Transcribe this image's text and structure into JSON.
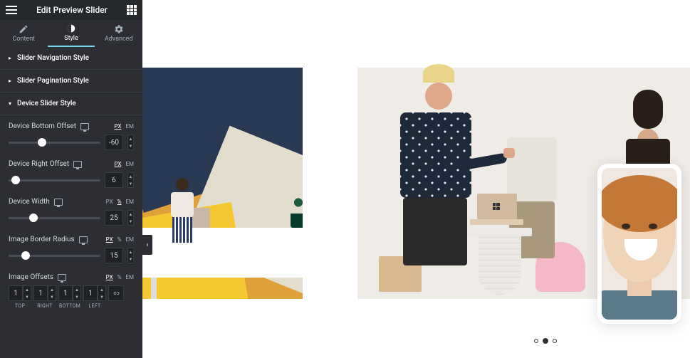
{
  "header": {
    "title": "Edit Preview Slider"
  },
  "tabs": {
    "content": "Content",
    "style": "Style",
    "advanced": "Advanced"
  },
  "sections": {
    "nav": "Slider Navigation Style",
    "pag": "Slider Pagination Style",
    "device": "Device Slider Style"
  },
  "controls": {
    "bottom_offset": {
      "label": "Device Bottom Offset",
      "value": "-60",
      "units": [
        "PX",
        "EM"
      ],
      "active_unit": "PX"
    },
    "right_offset": {
      "label": "Device Right Offset",
      "value": "6",
      "units": [
        "PX",
        "EM"
      ],
      "active_unit": "PX"
    },
    "device_width": {
      "label": "Device Width",
      "value": "25",
      "units": [
        "PX",
        "%",
        "EM"
      ],
      "active_unit": "%"
    },
    "border_radius": {
      "label": "Image Border Radius",
      "value": "15",
      "units": [
        "PX",
        "%",
        "EM"
      ],
      "active_unit": "PX"
    },
    "offsets": {
      "label": "Image Offsets",
      "units": [
        "PX",
        "%",
        "EM"
      ],
      "active_unit": "PX",
      "top": {
        "label": "TOP",
        "value": "1"
      },
      "right": {
        "label": "RIGHT",
        "value": "1"
      },
      "bottom": {
        "label": "BOTTOM",
        "value": "1"
      },
      "left": {
        "label": "LEFT",
        "value": "1"
      }
    }
  }
}
